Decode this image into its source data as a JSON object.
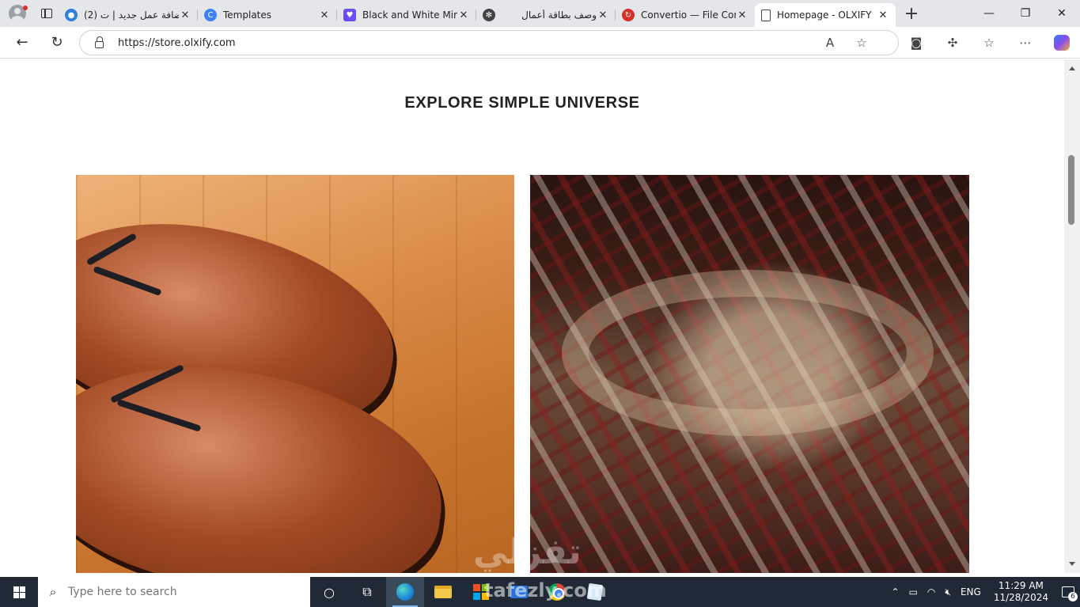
{
  "browser": {
    "tabs": [
      {
        "title": "(2) إضافة عمل جديد | ت",
        "favicon": "chat-bubble-icon",
        "favicon_color": "#2f7fe0"
      },
      {
        "title": "Templates",
        "favicon": "canva-icon",
        "favicon_color": "#3b82f6"
      },
      {
        "title": "Black and White Minim",
        "favicon": "canva-heart-icon",
        "favicon_color": "#6d4cf5"
      },
      {
        "title": "وصف بطاقة أعمال",
        "favicon": "openai-icon",
        "favicon_color": "#444444"
      },
      {
        "title": "Convertio — File Conv",
        "favicon": "convertio-icon",
        "favicon_color": "#d93025"
      },
      {
        "title": "Homepage - OLXIFY",
        "favicon": "page-icon",
        "favicon_color": "#ffffff",
        "active": true
      }
    ],
    "new_tab": "+",
    "url": "https://store.olxify.com",
    "window_controls": {
      "minimize": "—",
      "restore": "❐",
      "close": "✕"
    }
  },
  "page": {
    "heading": "EXPLORE SIMPLE UNIVERSE",
    "tiles": [
      {
        "name": "shoes-image",
        "alt": "brown leather shoes"
      },
      {
        "name": "shirt-image",
        "alt": "plaid shirt"
      }
    ]
  },
  "taskbar": {
    "search_placeholder": "Type here to search",
    "language": "ENG",
    "time": "11:29 AM",
    "date": "11/28/2024",
    "notification_count": "6"
  },
  "watermark": {
    "arabic": "تفزلي",
    "latin": "tafezly.com"
  }
}
